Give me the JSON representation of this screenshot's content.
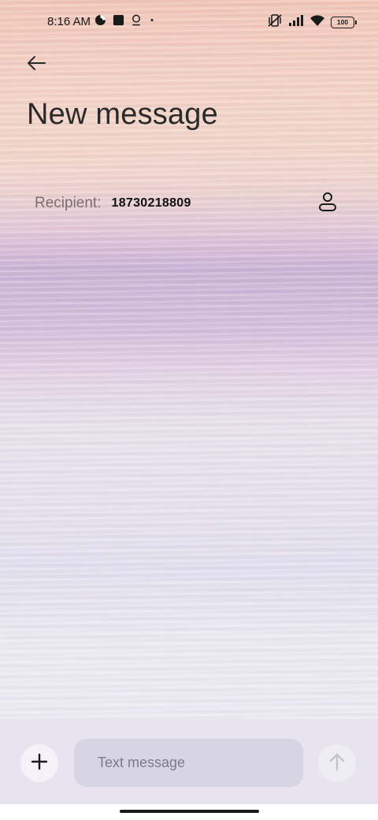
{
  "status_bar": {
    "time": "8:16 AM",
    "left_icons": [
      "data-saver-icon",
      "stop-square-icon",
      "location-pin-icon",
      "dot-icon"
    ],
    "right_icons": [
      "vibrate-off-icon",
      "signal-icon",
      "wifi-icon"
    ],
    "battery_level": "100"
  },
  "header": {
    "back_icon": "arrow-left-icon",
    "title": "New message"
  },
  "recipient": {
    "label": "Recipient:",
    "value": "18730218809",
    "contact_icon": "person-icon"
  },
  "compose": {
    "add_icon": "plus-icon",
    "placeholder": "Text message",
    "value": "",
    "send_icon": "arrow-up-icon"
  },
  "colors": {
    "text_primary": "#2a2a2a",
    "label_muted": "#7a6e72",
    "compose_bg": "#e7e4f0",
    "field_bg": "#d8d5e2",
    "send_disabled": "#c4c2cc"
  }
}
